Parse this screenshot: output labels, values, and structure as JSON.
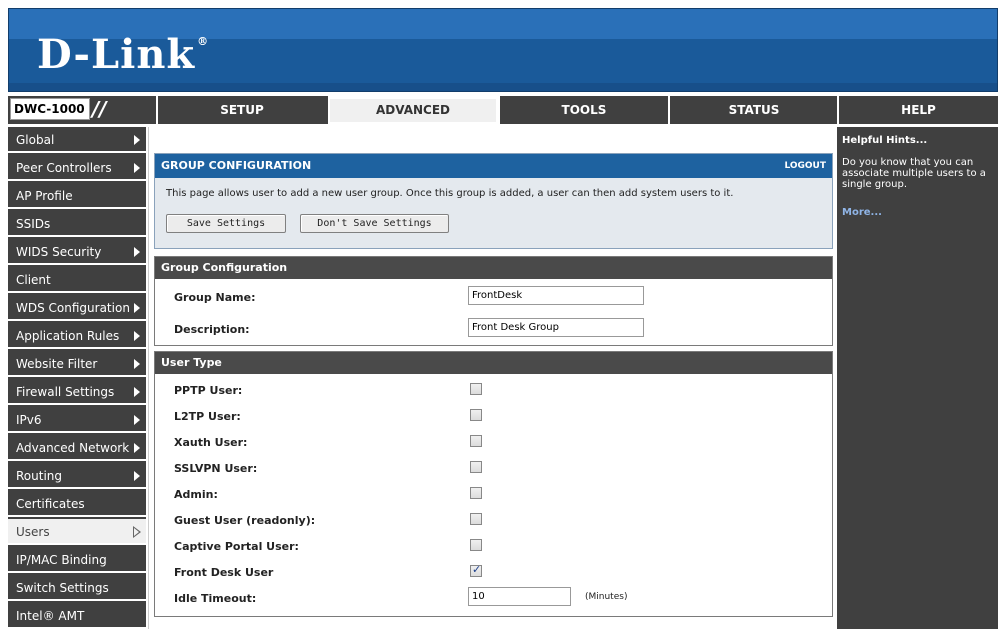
{
  "brand": {
    "logo_text": "D-Link",
    "logo_reg": "®"
  },
  "model": {
    "name": "DWC-1000",
    "slash": "//"
  },
  "nav": {
    "tabs": [
      {
        "label": "SETUP"
      },
      {
        "label": "ADVANCED"
      },
      {
        "label": "TOOLS"
      },
      {
        "label": "STATUS"
      },
      {
        "label": "HELP"
      }
    ],
    "active": "ADVANCED"
  },
  "sidebar": {
    "items": [
      {
        "label": "Global"
      },
      {
        "label": "Peer Controllers"
      },
      {
        "label": "AP Profile"
      },
      {
        "label": "SSIDs"
      },
      {
        "label": "WIDS Security"
      },
      {
        "label": "Client"
      },
      {
        "label": "WDS Configuration"
      },
      {
        "label": "Application Rules"
      },
      {
        "label": "Website Filter"
      },
      {
        "label": "Firewall Settings"
      },
      {
        "label": "IPv6"
      },
      {
        "label": "Advanced Network"
      },
      {
        "label": "Routing"
      },
      {
        "label": "Certificates"
      },
      {
        "label": "Users"
      },
      {
        "label": "IP/MAC Binding"
      },
      {
        "label": "Switch Settings"
      },
      {
        "label": "Intel® AMT"
      }
    ],
    "active": "Users"
  },
  "config": {
    "title": "GROUP CONFIGURATION",
    "logout": "LOGOUT",
    "description": "This page allows user to add a new user group. Once this group is added, a user can then add system users to it.",
    "save_label": "Save Settings",
    "dont_save_label": "Don't Save Settings"
  },
  "group": {
    "title": "Group Configuration",
    "name_label": "Group Name:",
    "name_value": "FrontDesk",
    "desc_label": "Description:",
    "desc_value": "Front Desk Group"
  },
  "user_type": {
    "title": "User Type",
    "items": [
      {
        "label": "PPTP User:",
        "checked": false
      },
      {
        "label": "L2TP User:",
        "checked": false
      },
      {
        "label": "Xauth User:",
        "checked": false
      },
      {
        "label": "SSLVPN User:",
        "checked": false
      },
      {
        "label": "Admin:",
        "checked": false
      },
      {
        "label": "Guest User (readonly):",
        "checked": false
      },
      {
        "label": "Captive Portal User:",
        "checked": false
      },
      {
        "label": "Front Desk User",
        "checked": true
      }
    ],
    "idle_label": "Idle Timeout:",
    "idle_value": "10",
    "idle_unit": "(Minutes)"
  },
  "help": {
    "title": "Helpful Hints...",
    "text": "Do you know that you can associate multiple users to a single group.",
    "more": "More..."
  }
}
